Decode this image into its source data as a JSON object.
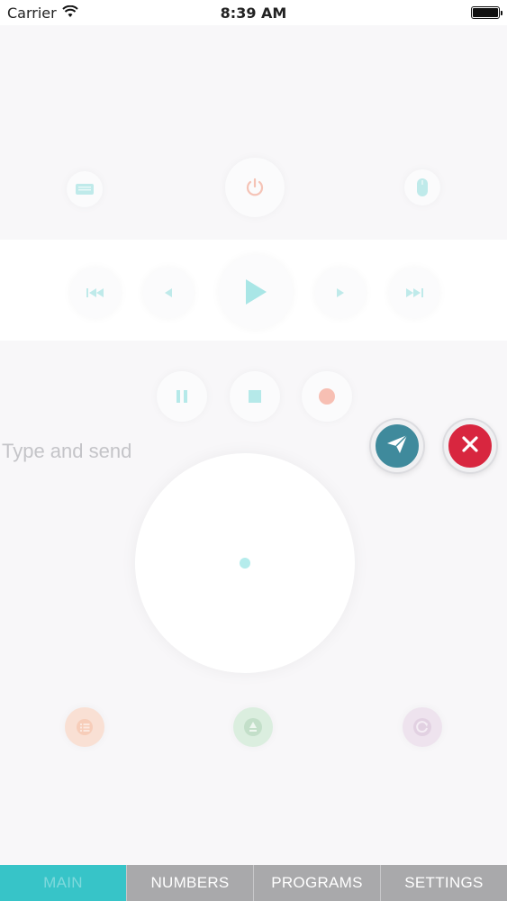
{
  "status_bar": {
    "carrier": "Carrier",
    "time": "8:39 AM",
    "battery_level": 1.0
  },
  "top_row": [
    {
      "name": "keyboard-icon"
    },
    {
      "name": "power-icon"
    },
    {
      "name": "mouse-icon"
    }
  ],
  "media_row": [
    {
      "name": "skip-previous-icon"
    },
    {
      "name": "rewind-icon"
    },
    {
      "name": "play-icon"
    },
    {
      "name": "fast-forward-icon"
    },
    {
      "name": "skip-next-icon"
    }
  ],
  "control_row": [
    {
      "name": "pause-icon"
    },
    {
      "name": "stop-icon"
    },
    {
      "name": "record-icon"
    }
  ],
  "text_entry": {
    "placeholder": "Type and send",
    "value": ""
  },
  "bottom_row": [
    {
      "name": "list-icon"
    },
    {
      "name": "eject-icon"
    },
    {
      "name": "refresh-icon"
    }
  ],
  "tabs": [
    {
      "label": "MAIN",
      "active": true
    },
    {
      "label": "NUMBERS",
      "active": false
    },
    {
      "label": "PROGRAMS",
      "active": false
    },
    {
      "label": "SETTINGS",
      "active": false
    }
  ],
  "colors": {
    "accent_teal": "#37c4c8",
    "send_button": "#3f8a9c",
    "cancel_button": "#d8263f",
    "icon_teal": "#9fe3e3",
    "record_red": "#f7bfb3",
    "list_orange": "#f7cdb9",
    "eject_green": "#c3dfc9",
    "refresh_purple": "#e2d1e2"
  }
}
